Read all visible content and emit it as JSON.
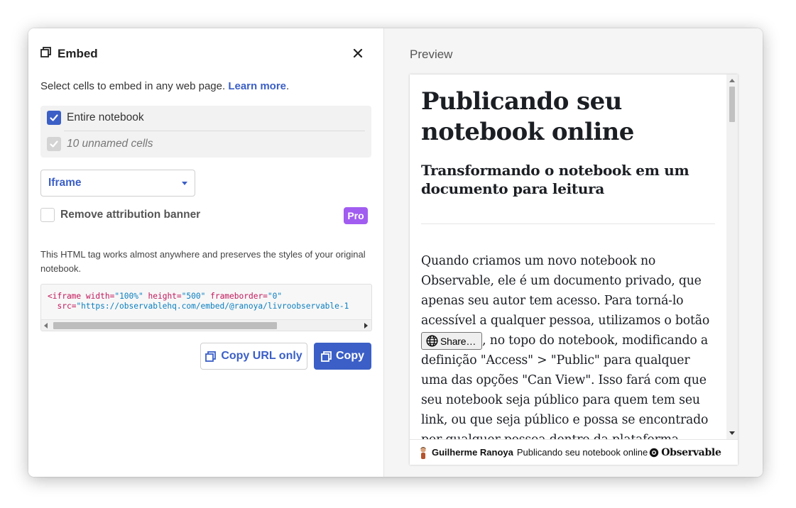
{
  "dialog": {
    "title": "Embed",
    "intro_text": "Select cells to embed in any web page.",
    "learn_more": "Learn more",
    "period": "."
  },
  "cells": {
    "entire_notebook": "Entire notebook",
    "unnamed_cells": "10 unnamed cells"
  },
  "format_select": {
    "value": "Iframe"
  },
  "attribution": {
    "label": "Remove attribution banner",
    "badge": "Pro"
  },
  "note": "This HTML tag works almost anywhere and preserves the styles of your original notebook.",
  "code": {
    "tag_open": "<iframe",
    "attr_width": "width=",
    "val_width": "\"100%\"",
    "attr_height": "height=",
    "val_height": "\"500\"",
    "attr_frameborder": "frameborder=",
    "val_frameborder": "\"0\"",
    "attr_src": "src=",
    "val_src": "\"https://observablehq.com/embed/@ranoya/livroobservable-1"
  },
  "buttons": {
    "copy_url": "Copy URL only",
    "copy": "Copy"
  },
  "preview": {
    "label": "Preview",
    "title": "Publicando seu notebook online",
    "subtitle": "Transformando o notebook em um documento para leitura",
    "para_before": "Quando criamos um novo notebook no Observable, ele é um documento privado, que apenas seu autor tem acesso. Para torná-lo acessível a qualquer pessoa, utilizamos o botão ",
    "share_button": "Share…",
    "para_after": ", no topo do notebook, modificando a definição \"Access\" > \"Public\" para qualquer uma das opções \"Can View\". Isso fará com que seu notebook seja público para quem tem seu link, ou que seja público e possa se encontrado por qualquer pessoa dentro da plataforma."
  },
  "banner": {
    "author": "Guilherme Ranoya",
    "notebook": "Publicando seu notebook online",
    "brand": "Observable"
  },
  "colors": {
    "accent": "#3b5fc6",
    "pro_badge": "#a15cf0",
    "code_tag": "#c2185b",
    "code_string": "#0a7fc1"
  }
}
